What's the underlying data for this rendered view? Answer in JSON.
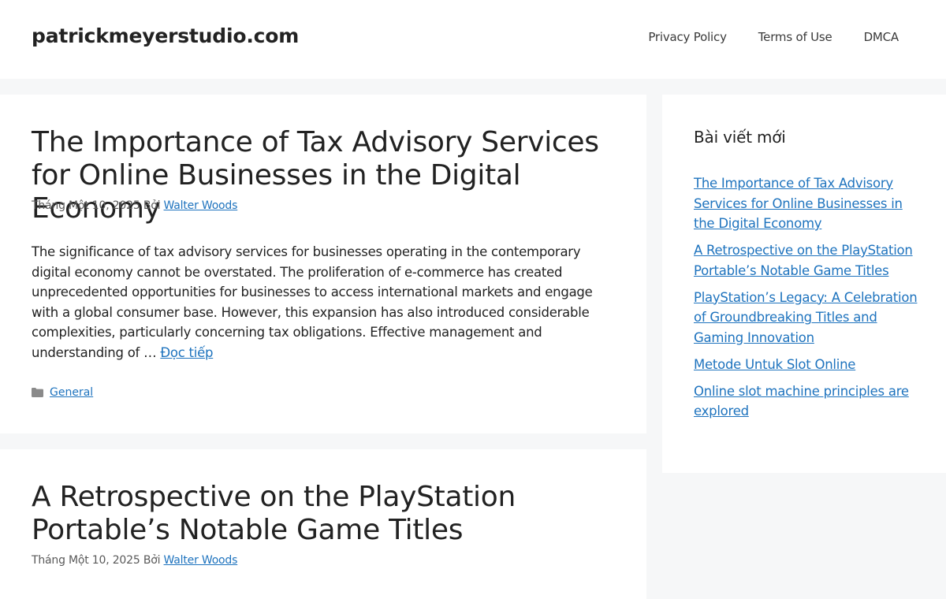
{
  "header": {
    "site_title": "patrickmeyerstudio.com",
    "nav": [
      "Privacy Policy",
      "Terms of Use",
      "DMCA"
    ]
  },
  "posts": [
    {
      "title": "The Importance of Tax Advisory Services for Online Businesses in the Digital Economy",
      "date": "Tháng Một 10, 2025",
      "by": "Bởi",
      "author": "Walter Woods",
      "excerpt": "The significance of tax advisory services for businesses operating in the contemporary digital economy cannot be overstated. The proliferation of e-commerce has created unprecedented opportunities for businesses to access international markets and engage with a global consumer base. However, this expansion has also introduced considerable complexities, particularly concerning tax obligations. Effective management and understanding of … ",
      "read_more": "Đọc tiếp",
      "category": "General"
    },
    {
      "title": "A Retrospective on the PlayStation Portable’s Notable Game Titles",
      "date": "Tháng Một 10, 2025",
      "by": "Bởi",
      "author": "Walter Woods"
    }
  ],
  "sidebar": {
    "widget_title": "Bài viết mới",
    "recent_posts": [
      "The Importance of Tax Advisory Services for Online Businesses in the Digital Economy",
      "A Retrospective on the PlayStation Portable’s Notable Game Titles",
      "PlayStation’s Legacy: A Celebration of Groundbreaking Titles and Gaming Innovation",
      "Metode Untuk Slot Online",
      "Online slot machine principles are explored"
    ]
  },
  "icons": {
    "category": "folder-icon"
  },
  "colors": {
    "link": "#1e73be",
    "background": "#f6f7f8",
    "card": "#ffffff",
    "text": "#222222"
  }
}
